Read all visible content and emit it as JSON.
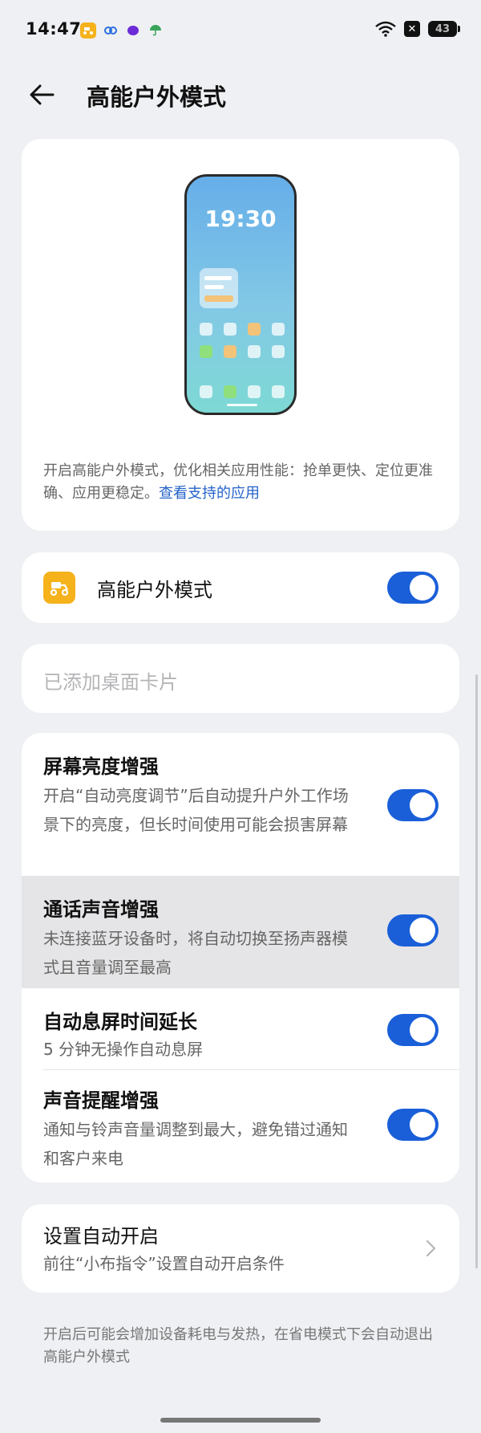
{
  "status_bar": {
    "time": "14:47",
    "battery": "43",
    "notification_icons": [
      "delivery-app-icon",
      "cloud-link-icon",
      "messenger-icon",
      "umbrella-icon"
    ]
  },
  "header": {
    "title": "高能户外模式"
  },
  "hero": {
    "phone_time": "19:30",
    "description": "开启高能户外模式，优化相关应用性能：抢单更快、定位更准确、应用更稳定。",
    "link": "查看支持的应用"
  },
  "main_toggle": {
    "label": "高能户外模式",
    "on": true
  },
  "widget_card": {
    "label": "已添加桌面卡片"
  },
  "features": [
    {
      "title": "屏幕亮度增强",
      "desc": "开启“自动亮度调节”后自动提升户外工作场景下的亮度，但长时间使用可能会损害屏幕",
      "on": true
    },
    {
      "title": "通话声音增强",
      "desc": "未连接蓝牙设备时，将自动切换至扬声器模式且音量调至最高",
      "on": true
    },
    {
      "title": "自动息屏时间延长",
      "desc": "5 分钟无操作自动息屏",
      "on": true
    },
    {
      "title": "声音提醒增强",
      "desc": "通知与铃声音量调整到最大，避免错过通知和客户来电",
      "on": true
    }
  ],
  "auto_start": {
    "title": "设置自动开启",
    "desc": "前往“小布指令”设置自动开启条件"
  },
  "footer": {
    "note": "开启后可能会增加设备耗电与发热，在省电模式下会自动退出高能户外模式"
  },
  "colors": {
    "accent": "#1a5fd8",
    "link": "#2463c9",
    "app_icon": "#f5b21b",
    "background": "#eff0f3"
  }
}
